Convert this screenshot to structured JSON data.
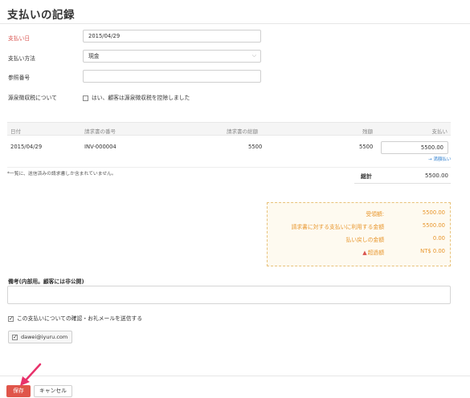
{
  "page": {
    "title": "支払いの記録"
  },
  "form": {
    "date_label": "支払い日",
    "date_value": "2015/04/29",
    "method_label": "支払い方法",
    "method_value": "現金",
    "reference_label": "参照番号",
    "reference_value": "",
    "tax_label": "源泉徴収税について",
    "tax_checkbox_label": "はい、顧客は源泉徴収税を控除しました"
  },
  "table": {
    "headers": [
      "日付",
      "請求書の番号",
      "請求書の総額",
      "残額",
      "支払い"
    ],
    "rows": [
      {
        "date": "2015/04/29",
        "invoice": "INV-000004",
        "amount": "5500",
        "balance": "5500",
        "payment": "5500.00"
      }
    ],
    "full_amount_link": "→ 満額払い",
    "footnote": "*一覧に、送信済みの請求書しか含まれていません。",
    "total_label": "総計",
    "total_value": "5500.00"
  },
  "summary": {
    "rows": [
      {
        "label": "受領額:",
        "value": "5500.00"
      },
      {
        "label": "請求書に対する支払いに利用する金額",
        "value": "5500.00"
      },
      {
        "label": "払い戻しの金額",
        "value": "0.00"
      },
      {
        "label": "超過額",
        "value": "NT$ 0.00"
      }
    ],
    "accent_color": "#e8962c",
    "warning_icon": "warning-icon"
  },
  "remarks": {
    "label": "備考(内部用。顧客には非公開)",
    "value": ""
  },
  "email": {
    "checkbox_label": "この支払いについての確認・お礼メールを送信する",
    "recipient": "dawei@iyuru.com"
  },
  "actions": {
    "save_label": "保存",
    "cancel_label": "キャンセル",
    "save_color": "#e0554a"
  }
}
